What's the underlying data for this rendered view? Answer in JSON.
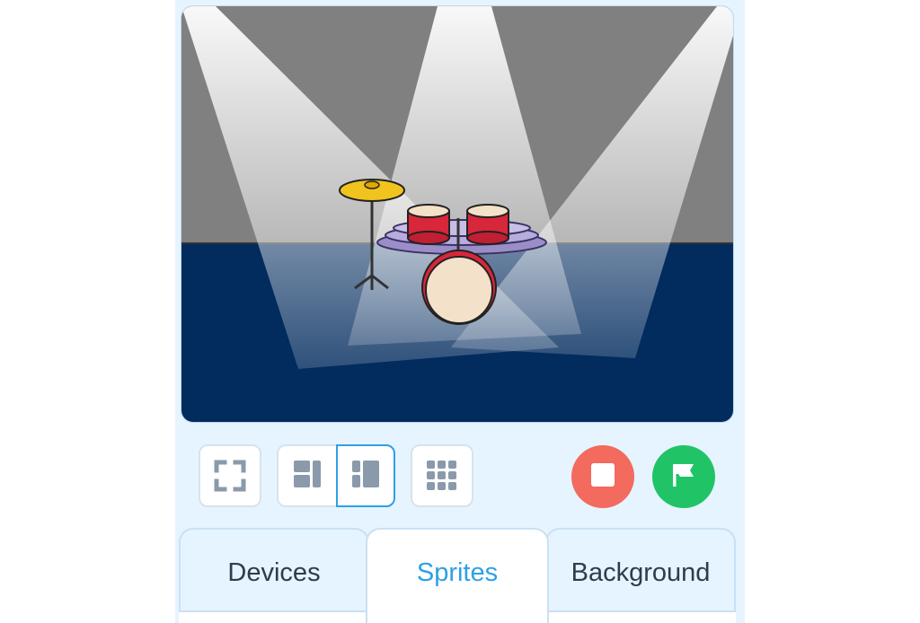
{
  "stage": {
    "colors": {
      "wall": "#808080",
      "floor": "#022b5e",
      "spotlight": "#ffffff"
    },
    "sprite_icon": "drum-kit-icon"
  },
  "toolbar": {
    "fullscreen_icon": "fullscreen-icon",
    "small_stage_icon": "small-stage-layout-icon",
    "large_stage_icon": "large-stage-layout-icon",
    "grid_icon": "grid-view-icon",
    "stop_icon": "stop-icon",
    "go_icon": "green-flag-icon",
    "colors": {
      "stop": "#f36a5e",
      "go": "#20c466",
      "selected_border": "#2ea0e6"
    }
  },
  "tabs": [
    {
      "label": "Devices",
      "active": false
    },
    {
      "label": "Sprites",
      "active": true
    },
    {
      "label": "Background",
      "active": false
    }
  ]
}
